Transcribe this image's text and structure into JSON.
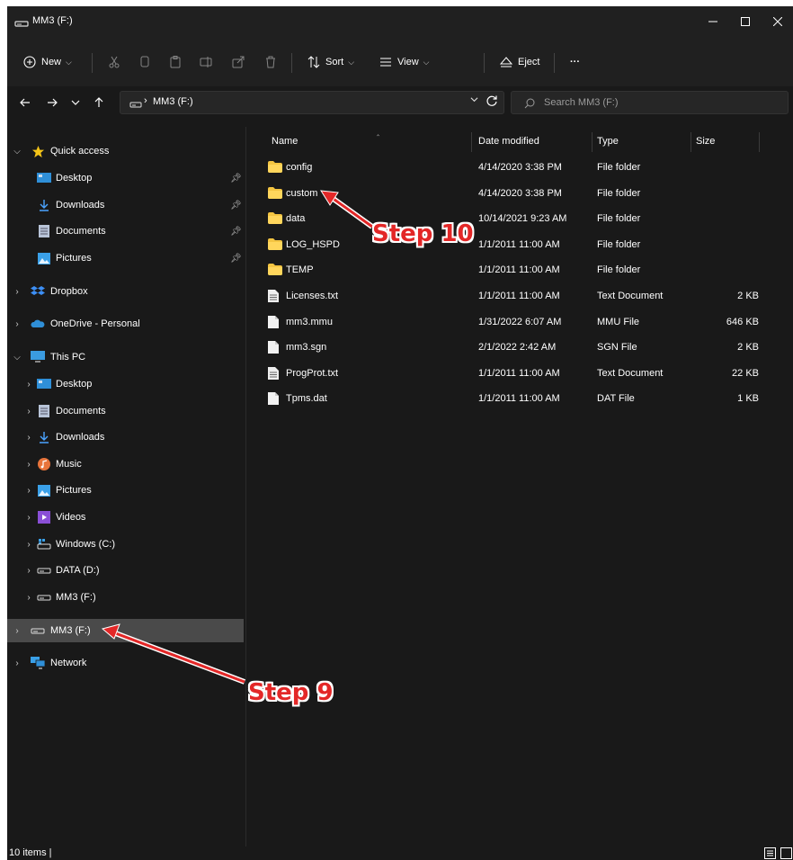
{
  "window": {
    "title": "MM3 (F:)"
  },
  "toolbar": {
    "new_label": "New",
    "sort_label": "Sort",
    "view_label": "View",
    "eject_label": "Eject",
    "more_label": "···"
  },
  "address": {
    "path": "MM3 (F:)",
    "search_placeholder": "Search MM3 (F:)"
  },
  "sidebar": {
    "quick_access": "Quick access",
    "qa_items": [
      {
        "label": "Desktop",
        "icon": "desktop-icon"
      },
      {
        "label": "Downloads",
        "icon": "download-icon"
      },
      {
        "label": "Documents",
        "icon": "documents-icon"
      },
      {
        "label": "Pictures",
        "icon": "pictures-icon"
      }
    ],
    "dropbox": "Dropbox",
    "onedrive": "OneDrive - Personal",
    "this_pc": "This PC",
    "pc_items": [
      {
        "label": "Desktop"
      },
      {
        "label": "Documents"
      },
      {
        "label": "Downloads"
      },
      {
        "label": "Music"
      },
      {
        "label": "Pictures"
      },
      {
        "label": "Videos"
      },
      {
        "label": "Windows (C:)"
      },
      {
        "label": "DATA (D:)"
      },
      {
        "label": "MM3 (F:)"
      }
    ],
    "drive_selected": "MM3 (F:)",
    "network": "Network"
  },
  "columns": {
    "name": "Name",
    "date": "Date modified",
    "type": "Type",
    "size": "Size"
  },
  "files": [
    {
      "name": "config",
      "date": "4/14/2020 3:38 PM",
      "type": "File folder",
      "size": "",
      "kind": "folder"
    },
    {
      "name": "custom",
      "date": "4/14/2020 3:38 PM",
      "type": "File folder",
      "size": "",
      "kind": "folder"
    },
    {
      "name": "data",
      "date": "10/14/2021 9:23 AM",
      "type": "File folder",
      "size": "",
      "kind": "folder"
    },
    {
      "name": "LOG_HSPD",
      "date": "1/1/2011 11:00 AM",
      "type": "File folder",
      "size": "",
      "kind": "folder"
    },
    {
      "name": "TEMP",
      "date": "1/1/2011 11:00 AM",
      "type": "File folder",
      "size": "",
      "kind": "folder"
    },
    {
      "name": "Licenses.txt",
      "date": "1/1/2011 11:00 AM",
      "type": "Text Document",
      "size": "2 KB",
      "kind": "text"
    },
    {
      "name": "mm3.mmu",
      "date": "1/31/2022 6:07 AM",
      "type": "MMU File",
      "size": "646 KB",
      "kind": "file"
    },
    {
      "name": "mm3.sgn",
      "date": "2/1/2022 2:42 AM",
      "type": "SGN File",
      "size": "2 KB",
      "kind": "file"
    },
    {
      "name": "ProgProt.txt",
      "date": "1/1/2011 11:00 AM",
      "type": "Text Document",
      "size": "22 KB",
      "kind": "text"
    },
    {
      "name": "Tpms.dat",
      "date": "1/1/2011 11:00 AM",
      "type": "DAT File",
      "size": "1 KB",
      "kind": "file"
    }
  ],
  "status": {
    "text": "10 items  |"
  },
  "annotations": {
    "step9": "Step 9",
    "step10": "Step 10",
    "color": "#e32727"
  }
}
